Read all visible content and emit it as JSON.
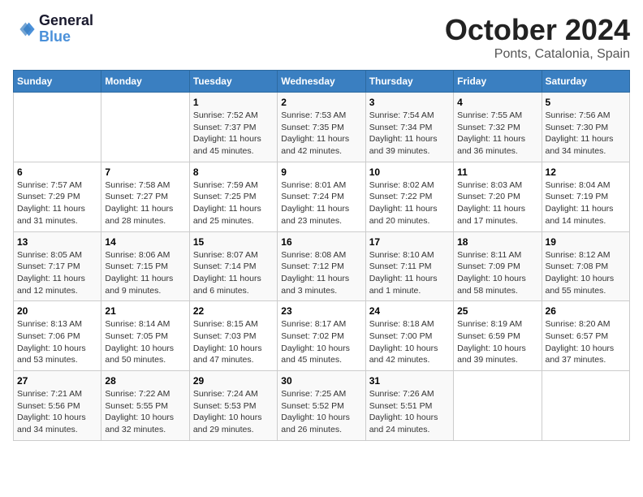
{
  "logo": {
    "line1": "General",
    "line2": "Blue"
  },
  "title": "October 2024",
  "subtitle": "Ponts, Catalonia, Spain",
  "headers": [
    "Sunday",
    "Monday",
    "Tuesday",
    "Wednesday",
    "Thursday",
    "Friday",
    "Saturday"
  ],
  "weeks": [
    [
      {
        "day": "",
        "detail": ""
      },
      {
        "day": "",
        "detail": ""
      },
      {
        "day": "1",
        "detail": "Sunrise: 7:52 AM\nSunset: 7:37 PM\nDaylight: 11 hours and 45 minutes."
      },
      {
        "day": "2",
        "detail": "Sunrise: 7:53 AM\nSunset: 7:35 PM\nDaylight: 11 hours and 42 minutes."
      },
      {
        "day": "3",
        "detail": "Sunrise: 7:54 AM\nSunset: 7:34 PM\nDaylight: 11 hours and 39 minutes."
      },
      {
        "day": "4",
        "detail": "Sunrise: 7:55 AM\nSunset: 7:32 PM\nDaylight: 11 hours and 36 minutes."
      },
      {
        "day": "5",
        "detail": "Sunrise: 7:56 AM\nSunset: 7:30 PM\nDaylight: 11 hours and 34 minutes."
      }
    ],
    [
      {
        "day": "6",
        "detail": "Sunrise: 7:57 AM\nSunset: 7:29 PM\nDaylight: 11 hours and 31 minutes."
      },
      {
        "day": "7",
        "detail": "Sunrise: 7:58 AM\nSunset: 7:27 PM\nDaylight: 11 hours and 28 minutes."
      },
      {
        "day": "8",
        "detail": "Sunrise: 7:59 AM\nSunset: 7:25 PM\nDaylight: 11 hours and 25 minutes."
      },
      {
        "day": "9",
        "detail": "Sunrise: 8:01 AM\nSunset: 7:24 PM\nDaylight: 11 hours and 23 minutes."
      },
      {
        "day": "10",
        "detail": "Sunrise: 8:02 AM\nSunset: 7:22 PM\nDaylight: 11 hours and 20 minutes."
      },
      {
        "day": "11",
        "detail": "Sunrise: 8:03 AM\nSunset: 7:20 PM\nDaylight: 11 hours and 17 minutes."
      },
      {
        "day": "12",
        "detail": "Sunrise: 8:04 AM\nSunset: 7:19 PM\nDaylight: 11 hours and 14 minutes."
      }
    ],
    [
      {
        "day": "13",
        "detail": "Sunrise: 8:05 AM\nSunset: 7:17 PM\nDaylight: 11 hours and 12 minutes."
      },
      {
        "day": "14",
        "detail": "Sunrise: 8:06 AM\nSunset: 7:15 PM\nDaylight: 11 hours and 9 minutes."
      },
      {
        "day": "15",
        "detail": "Sunrise: 8:07 AM\nSunset: 7:14 PM\nDaylight: 11 hours and 6 minutes."
      },
      {
        "day": "16",
        "detail": "Sunrise: 8:08 AM\nSunset: 7:12 PM\nDaylight: 11 hours and 3 minutes."
      },
      {
        "day": "17",
        "detail": "Sunrise: 8:10 AM\nSunset: 7:11 PM\nDaylight: 11 hours and 1 minute."
      },
      {
        "day": "18",
        "detail": "Sunrise: 8:11 AM\nSunset: 7:09 PM\nDaylight: 10 hours and 58 minutes."
      },
      {
        "day": "19",
        "detail": "Sunrise: 8:12 AM\nSunset: 7:08 PM\nDaylight: 10 hours and 55 minutes."
      }
    ],
    [
      {
        "day": "20",
        "detail": "Sunrise: 8:13 AM\nSunset: 7:06 PM\nDaylight: 10 hours and 53 minutes."
      },
      {
        "day": "21",
        "detail": "Sunrise: 8:14 AM\nSunset: 7:05 PM\nDaylight: 10 hours and 50 minutes."
      },
      {
        "day": "22",
        "detail": "Sunrise: 8:15 AM\nSunset: 7:03 PM\nDaylight: 10 hours and 47 minutes."
      },
      {
        "day": "23",
        "detail": "Sunrise: 8:17 AM\nSunset: 7:02 PM\nDaylight: 10 hours and 45 minutes."
      },
      {
        "day": "24",
        "detail": "Sunrise: 8:18 AM\nSunset: 7:00 PM\nDaylight: 10 hours and 42 minutes."
      },
      {
        "day": "25",
        "detail": "Sunrise: 8:19 AM\nSunset: 6:59 PM\nDaylight: 10 hours and 39 minutes."
      },
      {
        "day": "26",
        "detail": "Sunrise: 8:20 AM\nSunset: 6:57 PM\nDaylight: 10 hours and 37 minutes."
      }
    ],
    [
      {
        "day": "27",
        "detail": "Sunrise: 7:21 AM\nSunset: 5:56 PM\nDaylight: 10 hours and 34 minutes."
      },
      {
        "day": "28",
        "detail": "Sunrise: 7:22 AM\nSunset: 5:55 PM\nDaylight: 10 hours and 32 minutes."
      },
      {
        "day": "29",
        "detail": "Sunrise: 7:24 AM\nSunset: 5:53 PM\nDaylight: 10 hours and 29 minutes."
      },
      {
        "day": "30",
        "detail": "Sunrise: 7:25 AM\nSunset: 5:52 PM\nDaylight: 10 hours and 26 minutes."
      },
      {
        "day": "31",
        "detail": "Sunrise: 7:26 AM\nSunset: 5:51 PM\nDaylight: 10 hours and 24 minutes."
      },
      {
        "day": "",
        "detail": ""
      },
      {
        "day": "",
        "detail": ""
      }
    ]
  ]
}
